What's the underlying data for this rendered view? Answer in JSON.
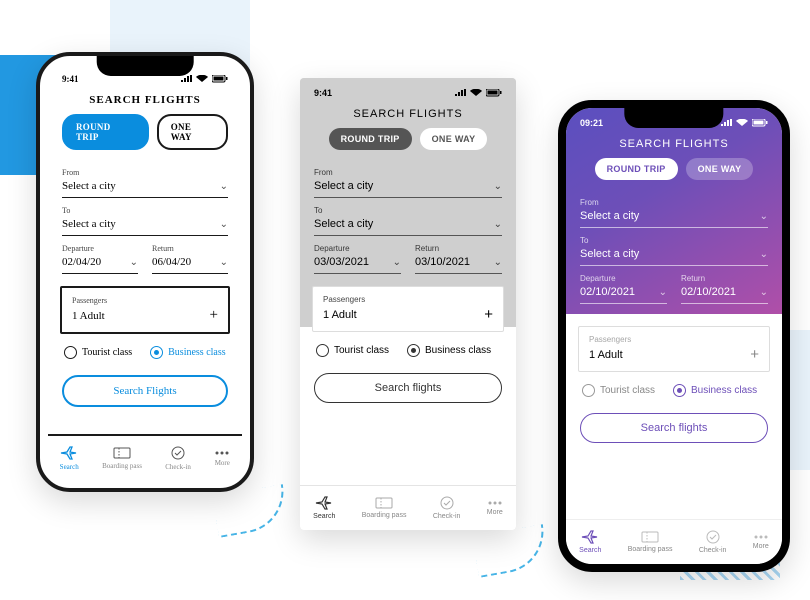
{
  "decor": {},
  "sketch": {
    "time": "9:41",
    "title": "SEARCH FLIGHTS",
    "tabs": {
      "round": "ROUND TRIP",
      "oneway": "ONE WAY"
    },
    "from_lbl": "From",
    "from_val": "Select a city",
    "to_lbl": "To",
    "to_val": "Select a city",
    "dep_lbl": "Departure",
    "dep_val": "02/04/20",
    "ret_lbl": "Return",
    "ret_val": "06/04/20",
    "pax_lbl": "Passengers",
    "pax_val": "1 Adult",
    "class_t": "Tourist class",
    "class_b": "Business class",
    "cta": "Search Flights",
    "tabbar": [
      "Search",
      "Boarding pass",
      "Check-in",
      "More"
    ]
  },
  "wire": {
    "time": "9:41",
    "title": "SEARCH FLIGHTS",
    "tabs": {
      "round": "ROUND TRIP",
      "oneway": "ONE WAY"
    },
    "from_lbl": "From",
    "from_val": "Select a city",
    "to_lbl": "To",
    "to_val": "Select a city",
    "dep_lbl": "Departure",
    "dep_val": "03/03/2021",
    "ret_lbl": "Return",
    "ret_val": "03/10/2021",
    "pax_lbl": "Passengers",
    "pax_val": "1 Adult",
    "class_t": "Tourist class",
    "class_b": "Business class",
    "cta": "Search flights",
    "tabbar": [
      "Search",
      "Boarding pass",
      "Check-in",
      "More"
    ]
  },
  "hifi": {
    "time": "09:21",
    "title": "SEARCH FLIGHTS",
    "tabs": {
      "round": "ROUND TRIP",
      "oneway": "ONE WAY"
    },
    "from_lbl": "From",
    "from_val": "Select a city",
    "to_lbl": "To",
    "to_val": "Select a city",
    "dep_lbl": "Departure",
    "dep_val": "02/10/2021",
    "ret_lbl": "Return",
    "ret_val": "02/10/2021",
    "pax_lbl": "Passengers",
    "pax_val": "1 Adult",
    "class_t": "Tourist class",
    "class_b": "Business class",
    "cta": "Search flights",
    "tabbar": [
      "Search",
      "Boarding pass",
      "Check-in",
      "More"
    ]
  }
}
